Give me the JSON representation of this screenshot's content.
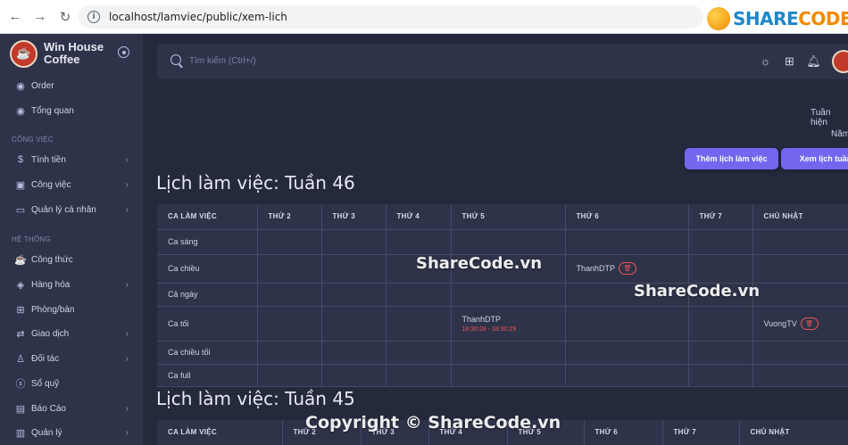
{
  "browser": {
    "url": "localhost/lamviec/public/xem-lich",
    "watermark_brand_a": "SHARE",
    "watermark_brand_b": "CODE.vn"
  },
  "sidebar": {
    "brand": "Win House Coffee",
    "items_top": [
      {
        "label": "Order",
        "icon": "eye-icon"
      },
      {
        "label": "Tổng quan",
        "icon": "eye-icon"
      }
    ],
    "section_work": "CÔNG VIỆC",
    "items_work": [
      {
        "label": "Tính tiền",
        "icon": "cash-icon"
      },
      {
        "label": "Công việc",
        "icon": "briefcase-icon"
      },
      {
        "label": "Quản lý cá nhân",
        "icon": "monitor-icon"
      }
    ],
    "section_system": "HỆ THỐNG",
    "items_system": [
      {
        "label": "Công thức",
        "icon": "coffee-icon"
      },
      {
        "label": "Hàng hóa",
        "icon": "box-icon"
      },
      {
        "label": "Phòng/bàn",
        "icon": "grid-icon"
      },
      {
        "label": "Giao dịch",
        "icon": "arrows-icon"
      },
      {
        "label": "Đối tác",
        "icon": "user-icon"
      },
      {
        "label": "Sổ quỹ",
        "icon": "dollar-icon"
      },
      {
        "label": "Báo Cáo",
        "icon": "report-icon"
      },
      {
        "label": "Quản lý",
        "icon": "manage-icon"
      }
    ]
  },
  "navbar": {
    "search_placeholder": "Tìm kiếm (Ctrl+/)"
  },
  "content": {
    "week_current_label": "Tuần hiện",
    "year_label": "Năm",
    "add_button": "Thêm lịch làm việc",
    "view_button": "Xem lịch tuần",
    "title_week46": "Lịch làm việc: Tuần 46",
    "title_week45": "Lịch làm việc: Tuần 45",
    "columns": [
      "CA LÀM VIỆC",
      "THỨ 2",
      "THỨ 3",
      "THỨ 4",
      "THỨ 5",
      "THỨ 6",
      "THỨ 7",
      "CHỦ NHẬT"
    ],
    "rows": [
      {
        "shift": "Ca sáng",
        "cells": [
          "",
          "",
          "",
          "",
          "",
          "",
          ""
        ]
      },
      {
        "shift": "Ca chiều",
        "cells": [
          "",
          "",
          "",
          "",
          "ThanhDTP",
          "",
          ""
        ]
      },
      {
        "shift": "Cả ngày",
        "cells": [
          "",
          "",
          "",
          "",
          "",
          "",
          ""
        ]
      },
      {
        "shift": "Ca tối",
        "cells": [
          "",
          "",
          "",
          "ThanhDTP",
          "",
          "",
          "VuongTV"
        ],
        "time_thu5": "18:30:28 - 18:30:29"
      },
      {
        "shift": "Ca chiều tối",
        "cells": [
          "",
          "",
          "",
          "",
          "",
          "",
          ""
        ]
      },
      {
        "shift": "Ca full",
        "cells": [
          "",
          "",
          "",
          "",
          "",
          "",
          ""
        ]
      }
    ]
  },
  "watermarks": {
    "center": "ShareCode.vn",
    "right": "ShareCode.vn",
    "copyright": "Copyright © ShareCode.vn"
  },
  "colors": {
    "primary": "#7367f0",
    "danger": "#ea5455",
    "background": "#25293c",
    "panel": "#2f3349"
  }
}
